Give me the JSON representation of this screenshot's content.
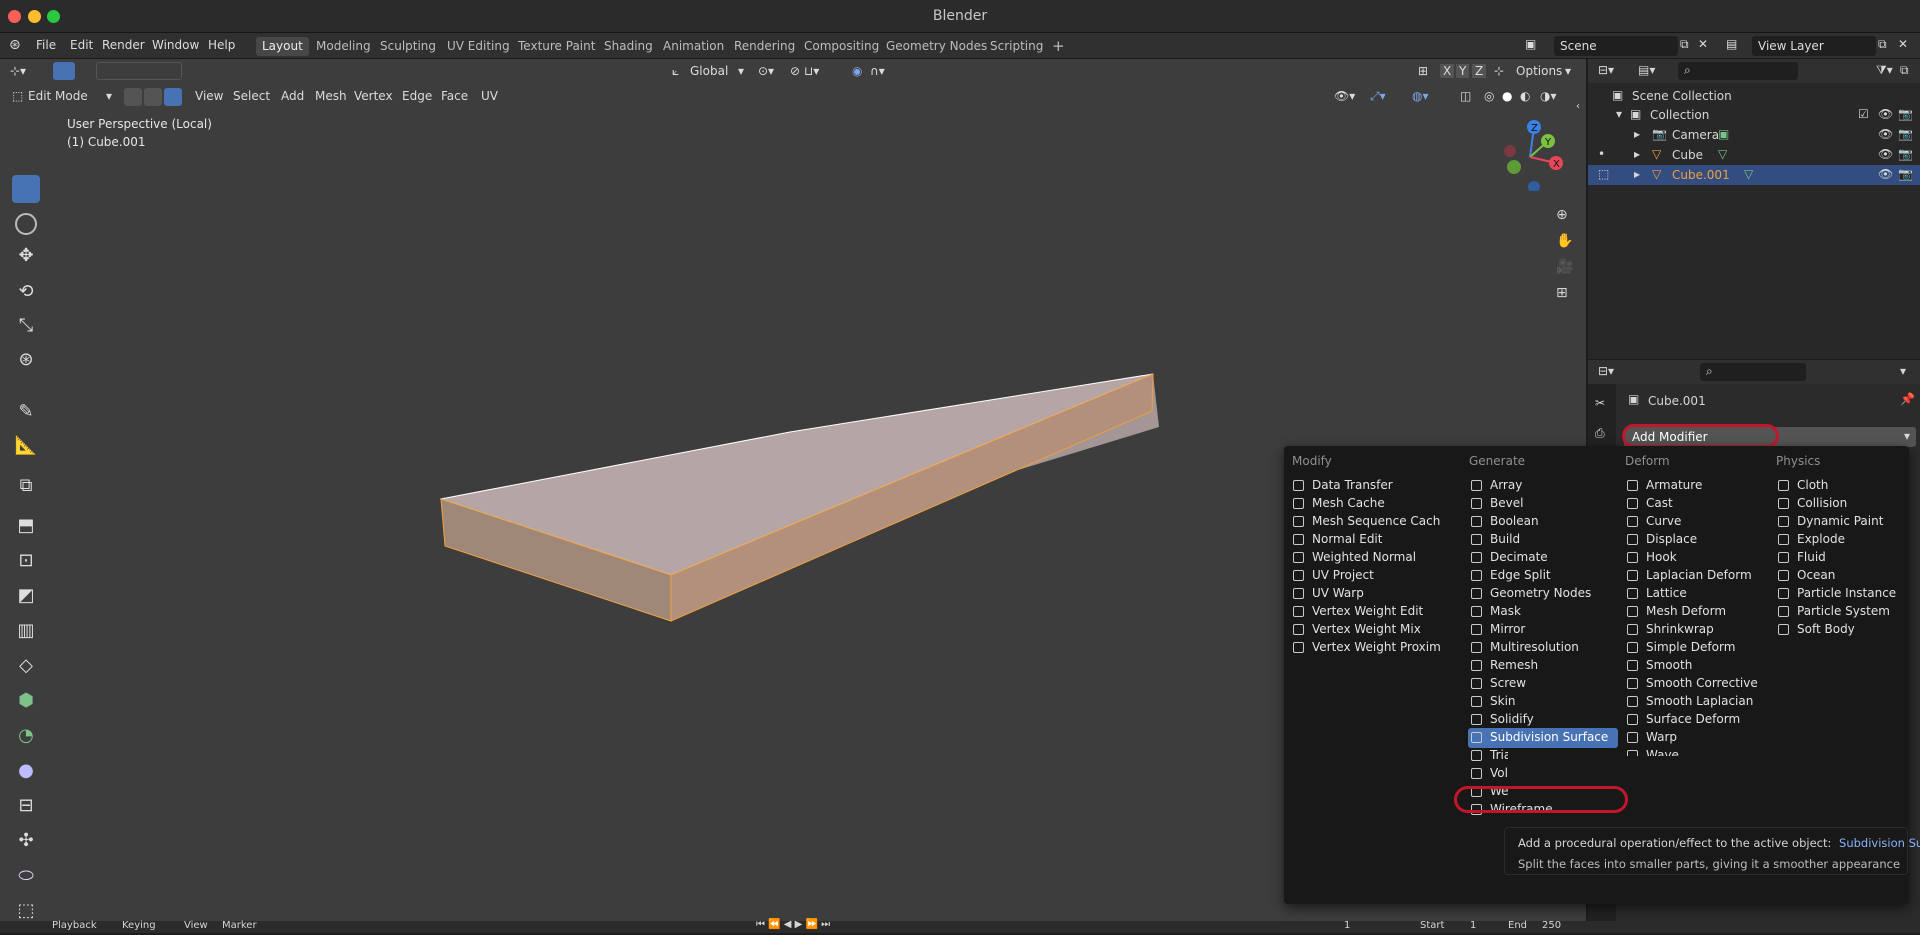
{
  "window": {
    "title": "Blender"
  },
  "menu": [
    "File",
    "Edit",
    "Render",
    "Window",
    "Help"
  ],
  "workspaces": [
    "Layout",
    "Modeling",
    "Sculpting",
    "UV Editing",
    "Texture Paint",
    "Shading",
    "Animation",
    "Rendering",
    "Compositing",
    "Geometry Nodes",
    "Scripting"
  ],
  "active_workspace": "Layout",
  "scene": {
    "scene_name": "Scene",
    "view_layer": "View Layer"
  },
  "viewport_header": {
    "mode": "Edit Mode",
    "menus": [
      "View",
      "Select",
      "Add",
      "Mesh",
      "Vertex",
      "Edge",
      "Face",
      "UV"
    ],
    "orientation": "Global",
    "options": "Options",
    "axes": [
      "X",
      "Y",
      "Z"
    ]
  },
  "viewport": {
    "perspective": "User Perspective (Local)",
    "object": "(1) Cube.001",
    "gizmo_axes": [
      "Z",
      "Y",
      "X"
    ]
  },
  "outliner": {
    "root": "Scene Collection",
    "items": [
      {
        "label": "Collection"
      },
      {
        "label": "Camera"
      },
      {
        "label": "Cube"
      },
      {
        "label": "Cube.001"
      }
    ]
  },
  "properties": {
    "object_name": "Cube.001",
    "add_modifier": "Add Modifier"
  },
  "modifier_menu": {
    "columns": [
      {
        "title": "Modify",
        "items": [
          "Data Transfer",
          "Mesh Cache",
          "Mesh Sequence Cache",
          "Normal Edit",
          "Weighted Normal",
          "UV Project",
          "UV Warp",
          "Vertex Weight Edit",
          "Vertex Weight Mix",
          "Vertex Weight Proximity"
        ]
      },
      {
        "title": "Generate",
        "items": [
          "Array",
          "Bevel",
          "Boolean",
          "Build",
          "Decimate",
          "Edge Split",
          "Geometry Nodes",
          "Mask",
          "Mirror",
          "Multiresolution",
          "Remesh",
          "Screw",
          "Skin",
          "Solidify",
          "Subdivision Surface",
          "Triangulate",
          "Volume to Mesh",
          "Weld",
          "Wireframe"
        ]
      },
      {
        "title": "Deform",
        "items": [
          "Armature",
          "Cast",
          "Curve",
          "Displace",
          "Hook",
          "Laplacian Deform",
          "Lattice",
          "Mesh Deform",
          "Shrinkwrap",
          "Simple Deform",
          "Smooth",
          "Smooth Corrective",
          "Smooth Laplacian",
          "Surface Deform",
          "Warp",
          "Wave"
        ]
      },
      {
        "title": "Physics",
        "items": [
          "Cloth",
          "Collision",
          "Dynamic Paint",
          "Explode",
          "Fluid",
          "Ocean",
          "Particle Instance",
          "Particle System",
          "Soft Body"
        ]
      }
    ],
    "highlighted": "Subdivision Surface"
  },
  "tooltip": {
    "line1": "Add a procedural operation/effect to the active object:",
    "line1_value": "Subdivision Surface",
    "line2": "Split the faces into smaller parts, giving it a smoother appearance"
  },
  "timeline": {
    "playback": "Playback",
    "keying": "Keying",
    "view": "View",
    "marker": "Marker",
    "current": "1",
    "start_label": "Start",
    "start": "1",
    "end_label": "End",
    "end": "250"
  },
  "colors": {
    "accent": "#4772b3",
    "highlight_circle": "#c4162a",
    "selected_object": "#f0a040"
  }
}
